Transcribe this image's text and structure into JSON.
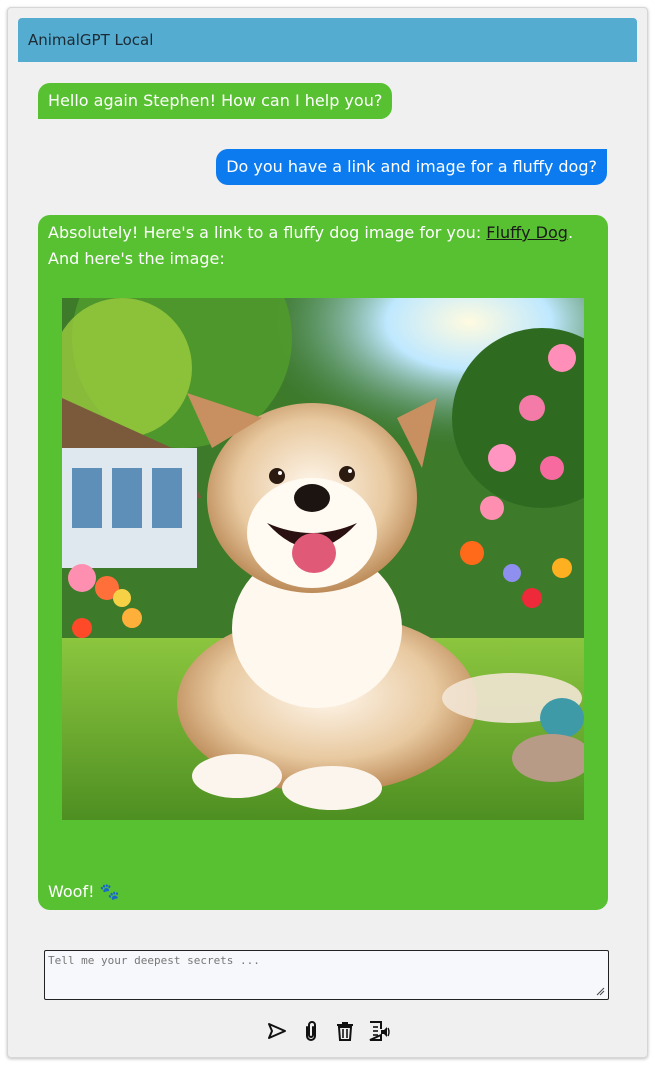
{
  "app": {
    "title": "AnimalGPT Local"
  },
  "messages": {
    "greeting": "Hello again Stephen! How can I help you?",
    "user_question": "Do you have a link and image for a fluffy dog?",
    "reply_intro": "Absolutely! Here's a link to a fluffy dog image for you: ",
    "reply_link_text": "Fluffy Dog",
    "reply_period": ".",
    "reply_image_intro": "And here's the image:",
    "reply_closing": "Woof! 🐾"
  },
  "composer": {
    "placeholder": "Tell me your deepest secrets ...",
    "value": ""
  },
  "toolbar": {
    "icons": [
      "send-icon",
      "attach-icon",
      "trash-icon",
      "read-aloud-icon"
    ]
  },
  "colors": {
    "header": "#54acd1",
    "bot_bubble": "#58c132",
    "user_bubble": "#0b7bef"
  }
}
